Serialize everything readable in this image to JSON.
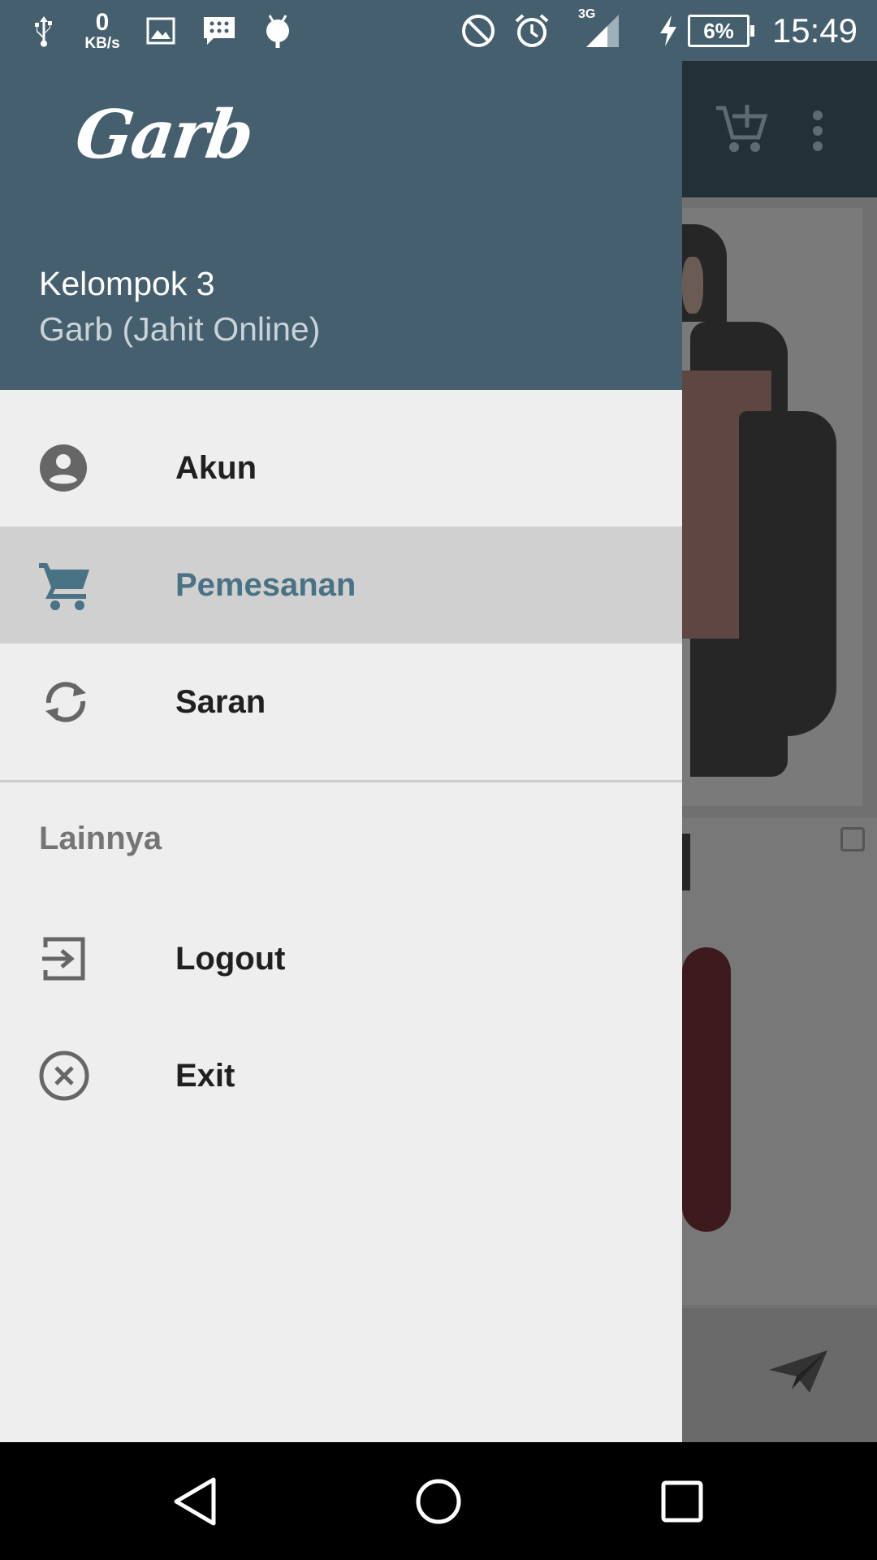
{
  "status_bar": {
    "network_speed_value": "0",
    "network_speed_unit": "KB/s",
    "network_type": "3G",
    "battery_level": "6%",
    "time": "15:49",
    "icons": [
      "usb-icon",
      "image-icon",
      "bbm-icon",
      "android-icon",
      "do-not-disturb-icon",
      "alarm-icon",
      "signal-icon",
      "charging-icon",
      "battery-icon"
    ]
  },
  "drawer": {
    "header": {
      "logo_text": "Garb",
      "title": "Kelompok 3",
      "subtitle": "Garb (Jahit Online)"
    },
    "primary_items": [
      {
        "label": "Akun",
        "icon": "account-circle-icon",
        "selected": false
      },
      {
        "label": "Pemesanan",
        "icon": "cart-icon",
        "selected": true
      },
      {
        "label": "Saran",
        "icon": "sync-icon",
        "selected": false
      }
    ],
    "section_label": "Lainnya",
    "secondary_items": [
      {
        "label": "Logout",
        "icon": "logout-icon"
      },
      {
        "label": "Exit",
        "icon": "close-circle-icon"
      }
    ]
  },
  "background_app": {
    "toolbar_icons": [
      "add-to-cart-icon",
      "more-vert-icon"
    ],
    "bottom_icon": "send-icon"
  },
  "nav_bar": {
    "buttons": [
      "back-icon",
      "home-icon",
      "recents-icon"
    ]
  },
  "colors": {
    "primary": "#455f6f",
    "selected_text": "#4a7285",
    "selected_bg": "#d0d0d0",
    "drawer_bg": "#eeeeee"
  }
}
